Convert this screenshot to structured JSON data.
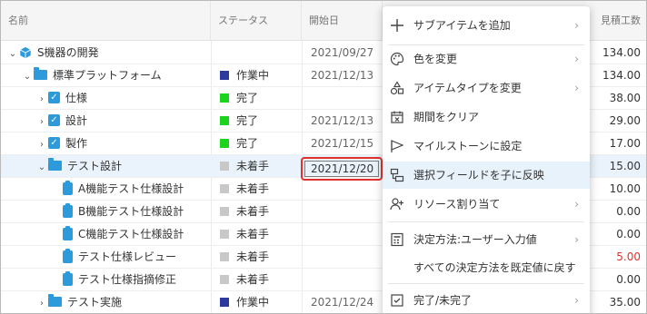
{
  "columns": {
    "name": "名前",
    "status": "ステータス",
    "start": "開始日",
    "work": "見積工数"
  },
  "rows": [
    {
      "chev": "⌄",
      "name": "S機器の開発",
      "icon": "cube",
      "indent": 0,
      "status": "",
      "status_color": "",
      "date": "2021/09/27",
      "work": "134.00"
    },
    {
      "chev": "⌄",
      "name": "標準プラットフォーム",
      "icon": "folder",
      "indent": 1,
      "status": "作業中",
      "status_color": "#2b3a9c",
      "date": "2021/12/13",
      "work": "134.00"
    },
    {
      "chev": "›",
      "name": "仕様",
      "icon": "check",
      "indent": 2,
      "status": "完了",
      "status_color": "#1ed31e",
      "date": "",
      "work": "38.00"
    },
    {
      "chev": "›",
      "name": "設計",
      "icon": "check",
      "indent": 2,
      "status": "完了",
      "status_color": "#1ed31e",
      "date": "2021/12/13",
      "work": "29.00"
    },
    {
      "chev": "›",
      "name": "製作",
      "icon": "check",
      "indent": 2,
      "status": "完了",
      "status_color": "#1ed31e",
      "date": "2021/12/15",
      "work": "17.00"
    },
    {
      "chev": "⌄",
      "name": "テスト設計",
      "icon": "folder",
      "indent": 2,
      "status": "未着手",
      "status_color": "#c8c8c8",
      "date": "2021/12/20",
      "work": "15.00",
      "selected": true
    },
    {
      "chev": "",
      "name": "A機能テスト仕様設計",
      "icon": "clip",
      "indent": 3,
      "status": "未着手",
      "status_color": "#c8c8c8",
      "date": "",
      "work": "10.00"
    },
    {
      "chev": "",
      "name": "B機能テスト仕様設計",
      "icon": "clip",
      "indent": 3,
      "status": "未着手",
      "status_color": "#c8c8c8",
      "date": "",
      "work": "0.00"
    },
    {
      "chev": "",
      "name": "C機能テスト仕様設計",
      "icon": "clip",
      "indent": 3,
      "status": "未着手",
      "status_color": "#c8c8c8",
      "date": "",
      "work": "0.00"
    },
    {
      "chev": "",
      "name": "テスト仕様レビュー",
      "icon": "clip",
      "indent": 3,
      "status": "未着手",
      "status_color": "#c8c8c8",
      "date": "",
      "work": "5.00",
      "work_red": true
    },
    {
      "chev": "",
      "name": "テスト仕様指摘修正",
      "icon": "clip",
      "indent": 3,
      "status": "未着手",
      "status_color": "#c8c8c8",
      "date": "",
      "work": "0.00"
    },
    {
      "chev": "›",
      "name": "テスト実施",
      "icon": "folder",
      "indent": 2,
      "status": "作業中",
      "status_color": "#2b3a9c",
      "date": "2021/12/24",
      "work": "35.00"
    }
  ],
  "menu": {
    "add_subitem": "サブアイテムを追加",
    "change_color": "色を変更",
    "change_type": "アイテムタイプを変更",
    "clear_period": "期間をクリア",
    "set_milestone": "マイルストーンに設定",
    "reflect_field": "選択フィールドを子に反映",
    "assign_resource": "リソース割り当て",
    "decide_method": "決定方法:ユーザー入力値",
    "reset_methods": "すべての決定方法を既定値に戻す",
    "done_toggle": "完了/未完了",
    "arrow": "›"
  },
  "colors": {
    "accent": "#2d9bdb",
    "highlight_border": "#e0312d",
    "done": "#1ed31e",
    "in_progress": "#2b3a9c",
    "not_started": "#c8c8c8"
  }
}
